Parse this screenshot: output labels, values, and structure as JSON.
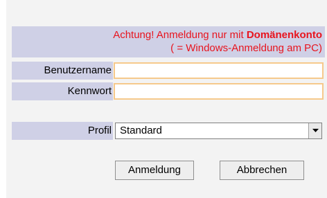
{
  "login": {
    "warning_prefix": "Achtung! Anmeldung nur mit ",
    "warning_bold": "Domänenkonto",
    "warning_line2": "( = Windows-Anmeldung am PC)",
    "username_label": "Benutzername",
    "username_value": "",
    "password_label": "Kennwort",
    "password_value": "",
    "profile_label": "Profil",
    "profile_selected": "Standard",
    "login_button": "Anmeldung",
    "cancel_button": "Abbrechen"
  },
  "colors": {
    "label_background": "#cfd0e6",
    "warning_text": "#e8141e",
    "field_border": "#f6c98b",
    "panel_background": "#f3f3f3"
  },
  "icons": {
    "dropdown": "chevron-down-icon"
  }
}
